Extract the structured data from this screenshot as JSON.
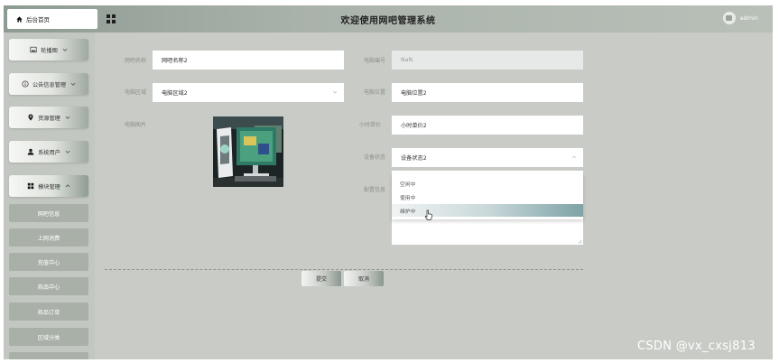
{
  "header": {
    "home_tab": "后台首页",
    "title": "欢迎使用网吧管理系统",
    "user_name": "admin"
  },
  "sidebar": {
    "menus": [
      {
        "label": "轮播图",
        "icon": "image-icon"
      },
      {
        "label": "公告信息管理",
        "icon": "info-icon"
      },
      {
        "label": "资源管理",
        "icon": "location-icon"
      },
      {
        "label": "系统用户",
        "icon": "user-icon"
      },
      {
        "label": "模块管理",
        "icon": "grid-icon"
      }
    ],
    "sub_items": [
      "网吧信息",
      "上网消费",
      "充值中心",
      "商品中心",
      "商品订单",
      "区域分类"
    ]
  },
  "form": {
    "name_label": "网吧名称",
    "name_value": "网吧名称2",
    "number_label": "电脑编号",
    "number_value": "NaN",
    "area_label": "电脑区域",
    "area_value": "电脑区域2",
    "location_label": "电脑位置",
    "location_value": "电脑位置2",
    "image_label": "电脑图片",
    "price_label": "小时单价",
    "price_value": "小时单价2",
    "status_label": "设备状态",
    "status_value": "设备状态2",
    "config_label": "配置信息",
    "status_options": [
      "空闲中",
      "使用中",
      "维护中"
    ],
    "submit_label": "提交",
    "cancel_label": "取消"
  },
  "watermark": "CSDN @vx_cxsj813",
  "colors": {
    "background": "#c9ccc6",
    "topbar": "#aab3ab",
    "sub_item": "#a9b0a8",
    "hover_accent": "#7fa3a6"
  }
}
